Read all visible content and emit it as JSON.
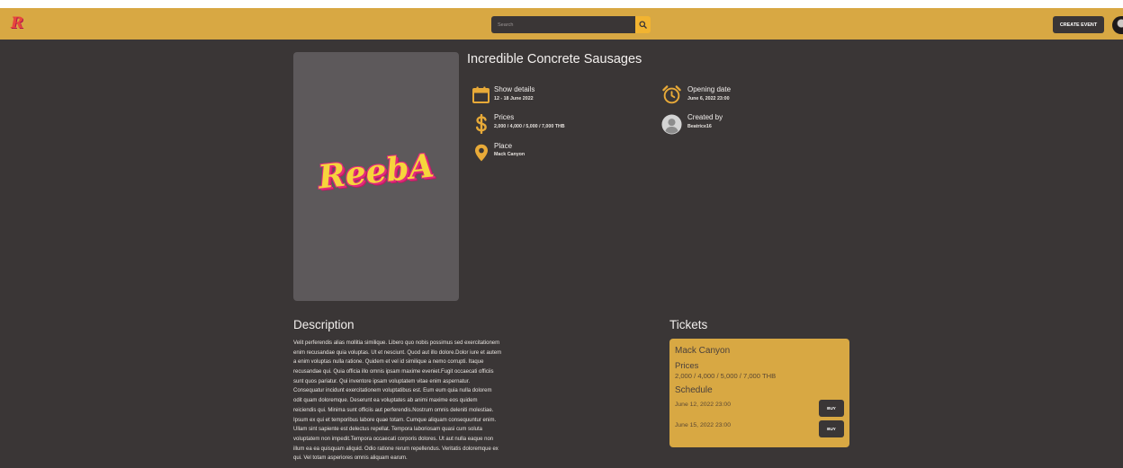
{
  "header": {
    "logo_text": "R",
    "search_placeholder": "Search",
    "search_button_icon": "search-icon",
    "create_event_label": "CREATE EVENT",
    "user_avatar_icon": "user-avatar-icon"
  },
  "event": {
    "title": "Incredible Concrete Sausages",
    "poster_logo_text": "ReebA",
    "show_details": {
      "label": "Show details",
      "value": "12 - 18 June 2022",
      "icon": "calendar-icon"
    },
    "prices": {
      "label": "Prices",
      "value": "2,000 / 4,000 / 5,000 / 7,000 THB",
      "icon": "dollar-icon"
    },
    "place": {
      "label": "Place",
      "value": "Mack Canyon",
      "icon": "map-pin-icon"
    },
    "opening_date": {
      "label": "Opening date",
      "value": "June 6, 2022 23:00",
      "icon": "alarm-clock-icon"
    },
    "created_by": {
      "label": "Created by",
      "value": "Beatrice16",
      "icon": "user-avatar-icon"
    }
  },
  "description": {
    "heading": "Description",
    "lines": [
      "Velit perferendis alias mollitia similique. Libero quo nobis possimus sed exercitationem",
      "enim recusandae quia voluptas. Ut et nesciunt. Quod aut illo dolore.Dolor iure et autem",
      "a enim voluptas nulla ratione. Quidem et vel id similique a nemo corrupti. Itaque",
      "recusandae qui. Quia officia illo omnis ipsam maxime eveniet.Fugit occaecati officiis",
      "sunt quos pariatur. Qui inventore ipsam voluptatem vitae enim aspernatur.",
      "Consequatur incidunt exercitationem voluptatibus est. Eum eum quia nulla dolorem",
      "odit quam doloremque. Deserunt ea voluptates ab animi maxime eos quidem",
      "reiciendis qui. Minima sunt officiis aut perferendis.Nostrum omnis deleniti molestiae.",
      "Ipsum ex qui et temporibus labore quae totam. Cumque aliquam consequuntur enim.",
      "Ullam sint sapiente est delectus repellat. Tempora laboriosam quasi cum soluta",
      "voluptatem non impedit.Tempora occaecati corporis dolores. Ut aut nulla eaque non",
      "illum ea ea quisquam aliquid. Odio ratione rerum repellendus. Veritatis doloremque ex",
      "qui. Vel totam asperiores omnis aliquam earum."
    ]
  },
  "tickets": {
    "heading": "Tickets",
    "cards": [
      {
        "place": "Mack Canyon",
        "prices_label": "Prices",
        "prices": "2,000 / 4,000 / 5,000 / 7,000 THB",
        "schedule_label": "Schedule",
        "schedule": [
          {
            "date": "June 12, 2022 23:00",
            "buy_label": "BUY"
          },
          {
            "date": "June 15, 2022 23:00",
            "buy_label": "BUY"
          }
        ]
      }
    ]
  },
  "colors": {
    "accent": "#d8a843",
    "search_button": "#f2b431",
    "background": "#3a3636",
    "poster": "#5d595b",
    "icon": "#e8aa38",
    "text": "#f1eeec",
    "card_text": "#4a403c",
    "card_value": "#5b4832"
  }
}
